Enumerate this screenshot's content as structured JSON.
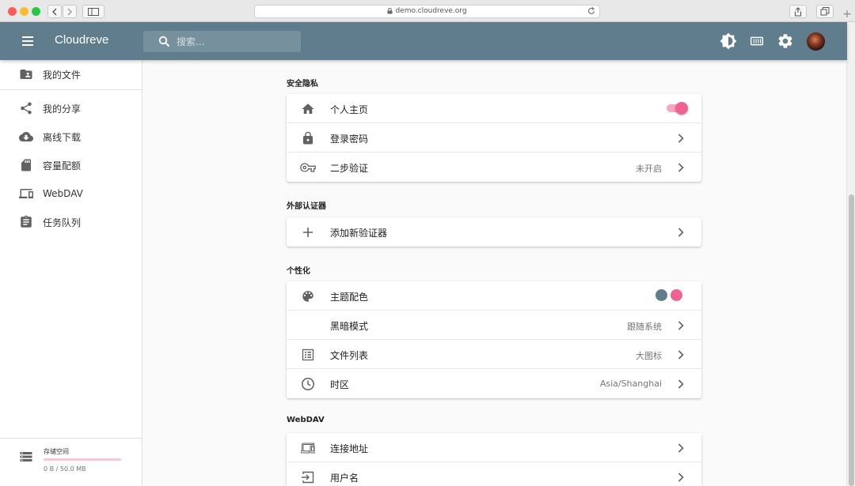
{
  "browser": {
    "url": "demo.cloudreve.org"
  },
  "appbar": {
    "title": "Cloudreve",
    "search_placeholder": "搜索..."
  },
  "sidebar": {
    "items": [
      {
        "label": "我的文件",
        "icon": "folder-account-icon"
      },
      {
        "label": "我的分享",
        "icon": "share-icon"
      },
      {
        "label": "离线下载",
        "icon": "cloud-download-icon"
      },
      {
        "label": "容量配额",
        "icon": "sd-card-icon"
      },
      {
        "label": "WebDAV",
        "icon": "devices-icon"
      },
      {
        "label": "任务队列",
        "icon": "clipboard-list-icon"
      }
    ],
    "storage": {
      "title": "存储空间",
      "usage": "0 B / 50.0 MB",
      "used_fraction": 0
    }
  },
  "sections": {
    "security": {
      "title": "安全隐私",
      "rows": [
        {
          "label": "个人主页",
          "icon": "home-icon",
          "toggle_on": true
        },
        {
          "label": "登录密码",
          "icon": "lock-icon"
        },
        {
          "label": "二步验证",
          "icon": "key-icon",
          "value": "未开启"
        }
      ]
    },
    "auth": {
      "title": "外部认证器",
      "rows": [
        {
          "label": "添加新验证器",
          "icon": "plus-icon"
        }
      ]
    },
    "personal": {
      "title": "个性化",
      "rows": [
        {
          "label": "主题配色",
          "icon": "palette-icon",
          "swatches": [
            "#5f7d8c",
            "#f06292"
          ]
        },
        {
          "label": "黑暗模式",
          "icon": "moon-icon",
          "value": "跟随系统"
        },
        {
          "label": "文件列表",
          "icon": "list-icon",
          "value": "大图标"
        },
        {
          "label": "时区",
          "icon": "clock-icon",
          "value": "Asia/Shanghai"
        }
      ]
    },
    "webdav": {
      "title": "WebDAV",
      "rows": [
        {
          "label": "连接地址",
          "icon": "devices-icon"
        },
        {
          "label": "用户名",
          "icon": "login-icon"
        }
      ]
    }
  },
  "colors": {
    "primary": "#5f7d8c",
    "accent": "#f06292"
  }
}
